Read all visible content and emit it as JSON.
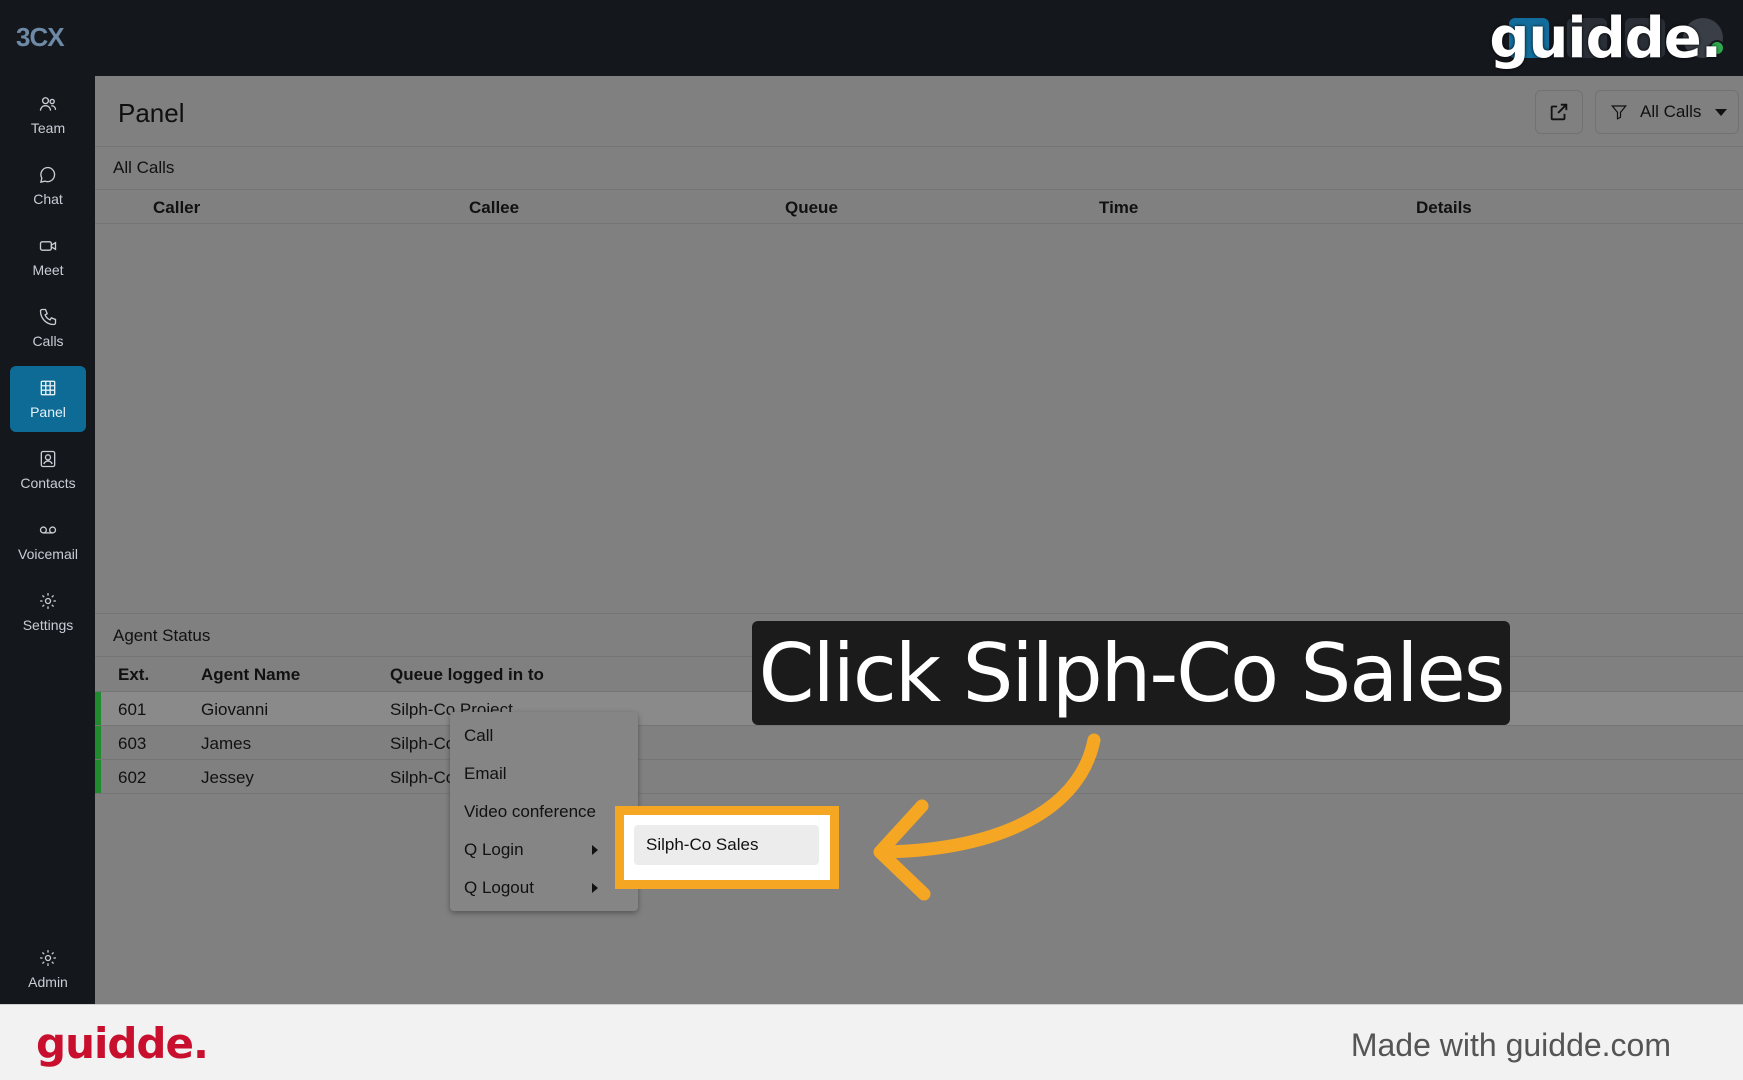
{
  "app": {
    "logo": "3CX"
  },
  "watermark": {
    "brand": "guidde."
  },
  "sidebar": {
    "items": [
      {
        "label": "Team",
        "icon": "team-icon"
      },
      {
        "label": "Chat",
        "icon": "chat-icon"
      },
      {
        "label": "Meet",
        "icon": "video-icon"
      },
      {
        "label": "Calls",
        "icon": "phone-icon"
      },
      {
        "label": "Panel",
        "icon": "grid-icon",
        "active": true
      },
      {
        "label": "Contacts",
        "icon": "contact-card-icon"
      },
      {
        "label": "Voicemail",
        "icon": "voicemail-icon"
      },
      {
        "label": "Settings",
        "icon": "gear-icon"
      }
    ],
    "admin": {
      "label": "Admin",
      "icon": "admin-gear-icon"
    }
  },
  "header": {
    "title": "Panel",
    "filter": {
      "label": "All Calls",
      "icon": "filter-icon"
    }
  },
  "all_calls": {
    "label": "All Calls",
    "columns": [
      "Caller",
      "Callee",
      "Queue",
      "Time",
      "Details"
    ]
  },
  "agent_status": {
    "label": "Agent Status",
    "columns": [
      "Ext.",
      "Agent Name",
      "Queue logged in to"
    ],
    "rows": [
      {
        "ext": "601",
        "name": "Giovanni",
        "queue": "Silph-Co Project"
      },
      {
        "ext": "603",
        "name": "James",
        "queue": "Silph-Co"
      },
      {
        "ext": "602",
        "name": "Jessey",
        "queue": "Silph-Co"
      }
    ]
  },
  "context_menu": {
    "items": [
      "Call",
      "Email",
      "Video conference",
      "Q Login",
      "Q Logout"
    ],
    "submenu": [
      "Silph-Co Sales"
    ]
  },
  "callout": {
    "text": "Click Silph-Co Sales"
  },
  "footer": {
    "brand": "guidde.",
    "made_with": "Made with guidde.com"
  },
  "colors": {
    "accent": "#0d6b96",
    "highlight": "#f5a623",
    "status_green": "#1f8a2e",
    "brand_red": "#c8102e"
  }
}
